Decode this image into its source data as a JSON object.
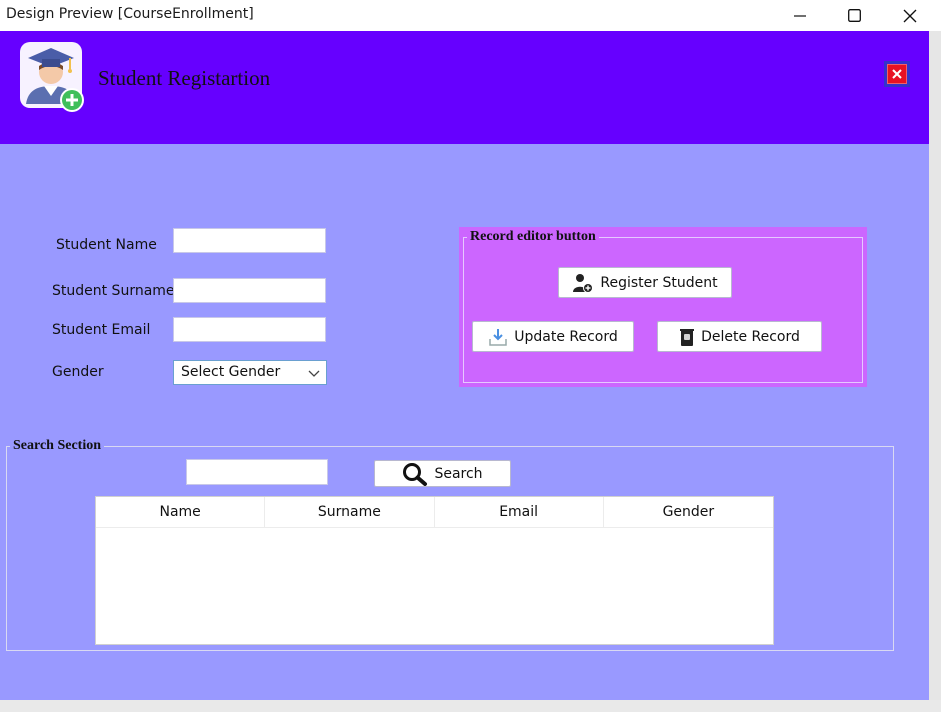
{
  "window": {
    "title": "Design Preview [CourseEnrollment]",
    "controls": [
      "minimize-icon",
      "maximize-icon",
      "close-icon"
    ]
  },
  "header": {
    "title": "Student Registartion",
    "icon": "student-graduate-add-icon",
    "close_icon": "close-icon",
    "colors": {
      "background": "#6600ff",
      "body": "#9999ff",
      "close": "#e81123"
    }
  },
  "form": {
    "name_label": "Student Name",
    "surname_label": "Student Surname",
    "email_label": "Student Email",
    "gender_label": "Gender",
    "name_value": "",
    "surname_value": "",
    "email_value": "",
    "gender_selected": "Select Gender"
  },
  "record_editor": {
    "title": "Record editor button",
    "register_label": "Register Student",
    "update_label": "Update Record",
    "delete_label": "Delete Record",
    "panel_color": "#cc66ff"
  },
  "search_section": {
    "title": "Search Section",
    "search_value": "",
    "search_label": "Search",
    "columns": [
      "Name",
      "Surname",
      "Email",
      "Gender"
    ],
    "rows": []
  }
}
